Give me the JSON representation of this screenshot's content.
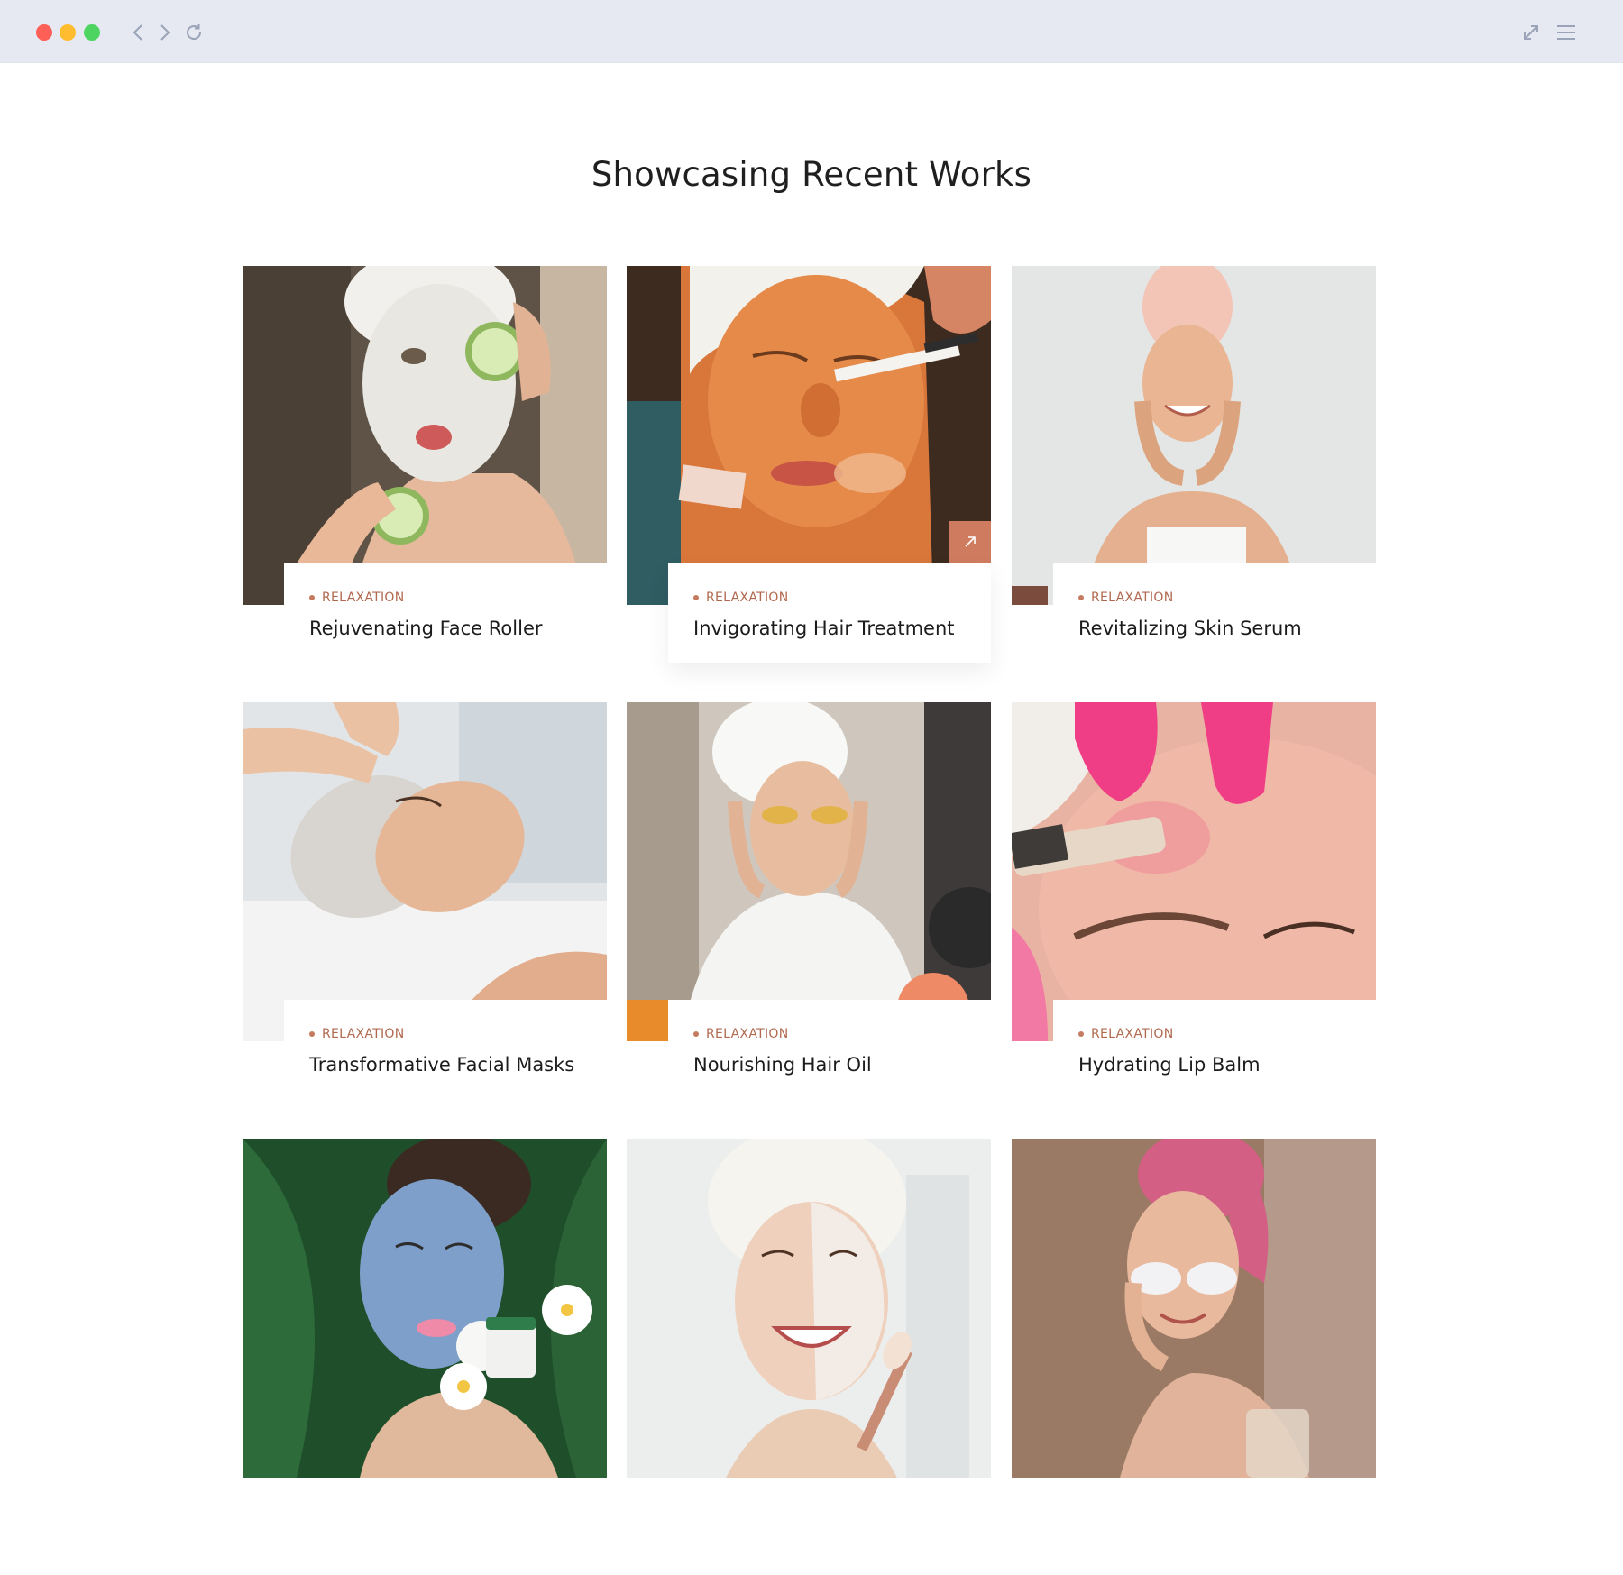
{
  "browser": {
    "window_controls": [
      "close",
      "minimize",
      "maximize"
    ],
    "nav_icons": [
      "back-icon",
      "forward-icon",
      "reload-icon"
    ],
    "right_icons": [
      "expand-icon",
      "menu-icon"
    ]
  },
  "section": {
    "title": "Showcasing Recent Works"
  },
  "works": [
    {
      "category": "Relaxation",
      "title": "Rejuvenating Face Roller",
      "photo": "woman with clay mask holding cucumber slices"
    },
    {
      "category": "Relaxation",
      "title": "Invigorating Hair Treatment",
      "photo": "facial treatment with brush",
      "hover": true
    },
    {
      "category": "Relaxation",
      "title": "Revitalizing Skin Serum",
      "photo": "smiling woman with pink towel"
    },
    {
      "category": "Relaxation",
      "title": "Transformative Facial Masks",
      "photo": "face massage at spa"
    },
    {
      "category": "Relaxation",
      "title": "Nourishing Hair Oil",
      "photo": "woman with gold eye patches"
    },
    {
      "category": "Relaxation",
      "title": "Hydrating Lip Balm",
      "photo": "cosmetic injection, pink gloves"
    },
    {
      "category": "",
      "title": "",
      "photo": "blue clay mask with flowers"
    },
    {
      "category": "",
      "title": "",
      "photo": "half face cream with towel"
    },
    {
      "category": "",
      "title": "",
      "photo": "woman with pink towel and under-eye patches"
    }
  ],
  "colors": {
    "accent": "#cf7b5f",
    "category_text": "#b0684e",
    "chrome_bg": "#e6e9f1"
  },
  "icons": {
    "card_link": "arrow-up-right-icon"
  }
}
